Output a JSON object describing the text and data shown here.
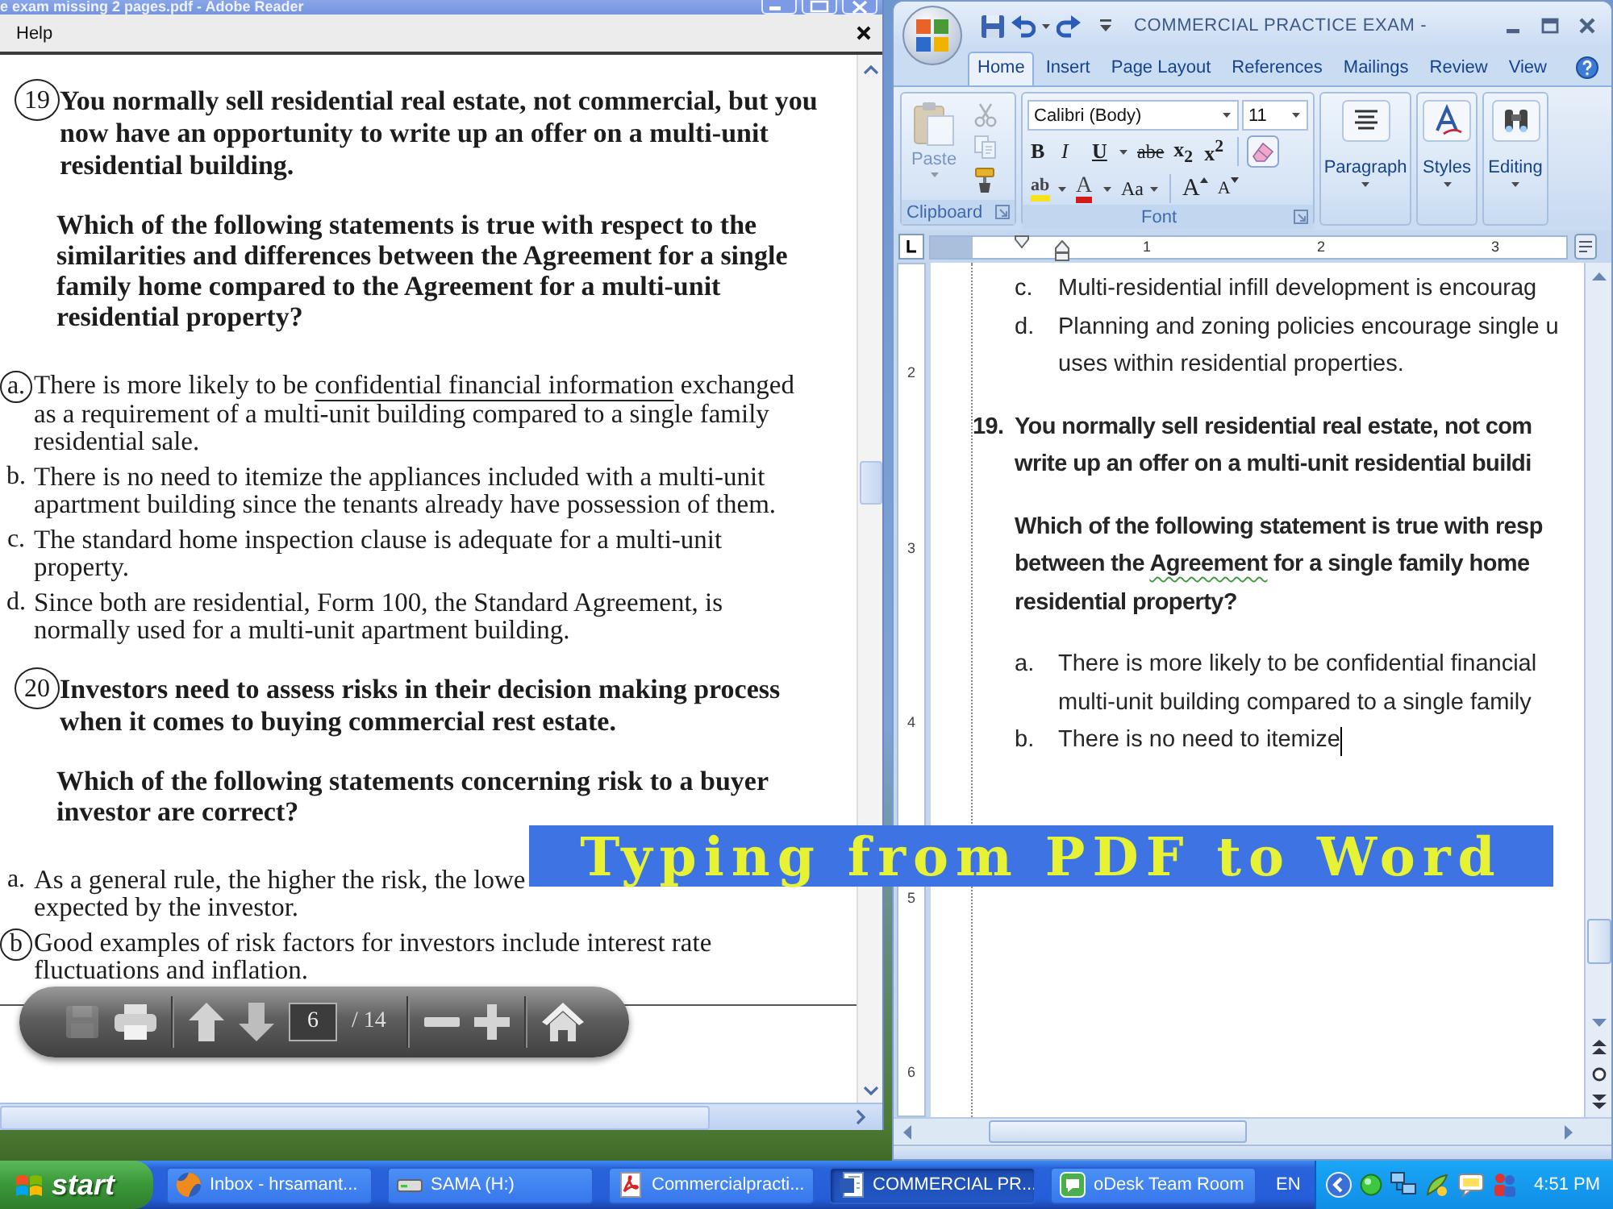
{
  "pdf_viewer": {
    "title": "e exam missing 2 pages.pdf - Adobe Reader",
    "menu": [
      "Help"
    ],
    "questions": [
      {
        "number": "19",
        "circled": true,
        "text": "You normally sell residential real estate, not commercial, but you\nnow have an opportunity to write up an offer on a multi-unit\nresidential building.",
        "prompt": "Which of the following statements is true with respect to the\nsimilarities and differences between the Agreement for a single\nfamily home compared to the Agreement for a multi-unit\nresidential property?",
        "options": [
          {
            "letter": "a.",
            "circled": true,
            "parts": [
              {
                "text": "There is more likely to be ",
                "ink_underline": false
              },
              {
                "text": "confidential financial information",
                "ink_underline": true
              },
              {
                "text": " exchanged\nas a requirement of a multi-unit building compared to a single family\nresidential sale.",
                "ink_underline": false
              }
            ]
          },
          {
            "letter": "b.",
            "circled": false,
            "parts": [
              {
                "text": "There is no need to itemize the appliances included with a multi-unit\napartment building since the tenants already have possession of them.",
                "ink_underline": false
              }
            ]
          },
          {
            "letter": "c.",
            "circled": false,
            "parts": [
              {
                "text": "The standard home inspection clause is adequate for a multi-unit\nproperty.",
                "ink_underline": false
              }
            ]
          },
          {
            "letter": "d.",
            "circled": false,
            "parts": [
              {
                "text": "Since both are residential, Form 100, the Standard Agreement, is\nnormally used for a multi-unit apartment building.",
                "ink_underline": false
              }
            ]
          }
        ]
      },
      {
        "number": "20",
        "circled": true,
        "text": "Investors need to assess risks in their decision making process\nwhen it comes to buying commercial rest estate.",
        "prompt": "Which of the following statements concerning risk to a buyer\ninvestor are correct?",
        "options": [
          {
            "letter": "a.",
            "circled": false,
            "parts": [
              {
                "text": "As a general rule, the higher the risk, the lowe\nexpected by the investor.",
                "ink_underline": false
              }
            ]
          },
          {
            "letter": "b",
            "circled": true,
            "parts": [
              {
                "text": "Good examples of risk factors for investors include interest rate\nfluctuations and inflation.",
                "ink_underline": false
              }
            ]
          }
        ]
      }
    ],
    "toolbar": [
      [
        {
          "kind": "save",
          "disabled": true
        },
        {
          "kind": "print",
          "disabled": false
        }
      ],
      [
        {
          "kind": "previous_page",
          "disabled": false
        },
        {
          "kind": "next_page",
          "disabled": false
        },
        {
          "kind": "page_field",
          "value": "6"
        },
        {
          "kind": "page_count",
          "text": "/ 14"
        }
      ],
      [
        {
          "kind": "zoom_out",
          "disabled": false
        },
        {
          "kind": "zoom_in",
          "disabled": false
        }
      ],
      [
        {
          "kind": "home",
          "disabled": false
        }
      ]
    ]
  },
  "word_window": {
    "title": "COMMERCIAL PRACTICE EXAM -",
    "tabs": [
      {
        "label": "Home",
        "selected": true
      },
      {
        "label": "Insert",
        "selected": false
      },
      {
        "label": "Page Layout",
        "selected": false
      },
      {
        "label": "References",
        "selected": false
      },
      {
        "label": "Mailings",
        "selected": false
      },
      {
        "label": "Review",
        "selected": false
      },
      {
        "label": "View",
        "selected": false
      }
    ],
    "clipboard": {
      "label": "Clipboard",
      "buttons": [
        {
          "kind": "paste",
          "label": "Paste",
          "disabled": true
        },
        {
          "kind": "cut",
          "disabled": true
        },
        {
          "kind": "copy",
          "disabled": true
        },
        {
          "kind": "format_painter",
          "disabled": false
        }
      ]
    },
    "font": {
      "label": "Font",
      "name": "Calibri (Body)",
      "size": "11",
      "rows": [
        [
          {
            "kind": "bold",
            "label": "B"
          },
          {
            "kind": "italic",
            "label": "I"
          },
          {
            "kind": "underline",
            "label": "U"
          },
          {
            "kind": "strikethrough",
            "label": "abe"
          },
          {
            "kind": "subscript",
            "label": "x$_{2}$"
          },
          {
            "kind": "superscript",
            "label": "x$^{2}$"
          },
          {
            "kind": "clear_formatting"
          }
        ],
        [
          {
            "kind": "highlight",
            "label": "ab"
          },
          {
            "kind": "font_color",
            "label": "A"
          },
          {
            "kind": "change_case",
            "label": "Aa"
          },
          {
            "kind": "grow_font",
            "label": "A"
          },
          {
            "kind": "shrink_font",
            "label": "A"
          }
        ]
      ]
    },
    "groups": [
      {
        "kind": "paragraph",
        "label": "Paragraph"
      },
      {
        "kind": "styles",
        "label": "Styles"
      },
      {
        "kind": "editing",
        "label": "Editing"
      }
    ],
    "ruler": [
      "1",
      "2",
      "3"
    ],
    "vertical_ruler": [
      "2",
      "3",
      "4",
      "5",
      "6"
    ],
    "document": [
      {
        "kind": "option",
        "marker": "c.",
        "text": "Multi-residential infill development is encourag",
        "cursor": false
      },
      {
        "kind": "option",
        "marker": "d.",
        "text": "Planning and zoning policies encourage single u\nuses within residential properties.",
        "cursor": false
      },
      {
        "kind": "question",
        "marker": "19.",
        "text": "You normally sell residential real estate, not com\nwrite up an offer on a multi-unit residential buildi",
        "cursor": false
      },
      {
        "kind": "prompt",
        "parts": [
          {
            "text": "Which of the following statement is true with resp\nbetween the ",
            "squiggle": false
          },
          {
            "text": "Agreement",
            "squiggle": true
          },
          {
            "text": " for a single family home\nresidential property?",
            "squiggle": false
          }
        ],
        "cursor": false
      },
      {
        "kind": "option",
        "marker": "a.",
        "text": "There is more likely to be confidential financial\nmulti-unit building compared to a single family",
        "cursor": false
      },
      {
        "kind": "option",
        "marker": "b.",
        "text": "There is no need to itemize",
        "cursor": true
      }
    ]
  },
  "caption_banner": {
    "text": "Typing from PDF to Word"
  },
  "taskbar": {
    "start": "start",
    "tasks": [
      {
        "kind": "browser",
        "label": "Inbox - hrsamant...",
        "selected": false
      },
      {
        "kind": "drive",
        "label": "SAMA (H:)",
        "selected": false
      },
      {
        "kind": "pdf",
        "label": "Commercialpracti...",
        "selected": false
      },
      {
        "kind": "word",
        "label": "COMMERCIAL PR...",
        "selected": true
      },
      {
        "kind": "chat",
        "label": "oDesk Team Room",
        "selected": false
      }
    ],
    "language": "EN",
    "clock": "4:51 PM"
  }
}
